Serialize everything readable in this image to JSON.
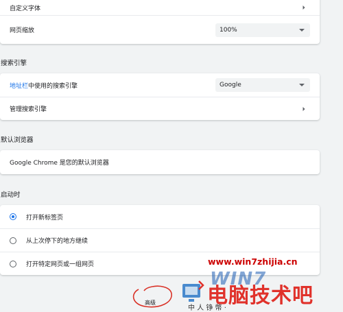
{
  "appearance": {
    "custom_fonts_label": "自定义字体",
    "page_zoom_label": "网页缩放",
    "page_zoom_value": "100%"
  },
  "search_engine": {
    "section_title": "搜索引擎",
    "address_bar_link": "地址栏",
    "address_bar_label_rest": "中使用的搜索引擎",
    "engine_value": "Google",
    "manage_label": "管理搜索引擎"
  },
  "default_browser": {
    "section_title": "默认浏览器",
    "status_text": "Google Chrome 是您的默认浏览器"
  },
  "on_startup": {
    "section_title": "启动时",
    "options": [
      {
        "label": "打开新标签页",
        "selected": true
      },
      {
        "label": "从上次停下的地方继续",
        "selected": false
      },
      {
        "label": "打开特定网页或一组网页",
        "selected": false
      }
    ]
  },
  "advanced_label": "高级",
  "watermark": {
    "url": "www.win7zhijia.cn",
    "logo_text": "WIN7",
    "site_name": "电脑技术吧",
    "small_text": "中 人 铮 幣 ·"
  },
  "colors": {
    "accent": "#1a73e8",
    "background": "#f1f3f4",
    "watermark_red": "#e0322b"
  }
}
